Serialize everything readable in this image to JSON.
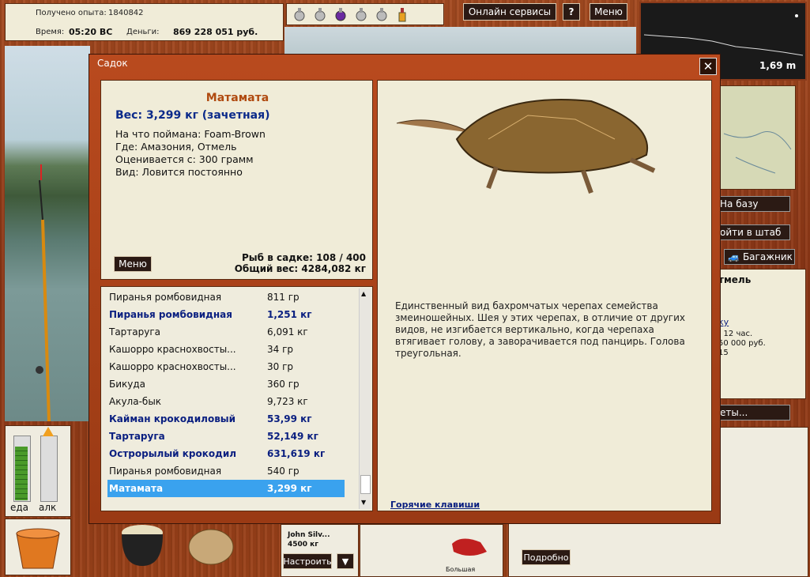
{
  "stats": {
    "xp_label": "Получено опыта:",
    "xp_value": "1840842",
    "time_label": "Время:",
    "time_value": "05:20 ВС",
    "money_label": "Деньги:",
    "money_value": "869 228 051 руб."
  },
  "topbar": {
    "online_services": "Онлайн сервисы",
    "help": "?",
    "menu": "Меню"
  },
  "depth": {
    "value": "1,69 m"
  },
  "dialog": {
    "title": "Садок",
    "close": "✕",
    "fish": {
      "name": "Матамата",
      "weight": "Вес: 3,299 кг (зачетная)",
      "caught_on": "На что поймана: Foam-Brown",
      "where": "Где: Амазония, Отмель",
      "valued_from": "Оценивается с: 300 грамм",
      "kind": "Вид: Ловится постоянно"
    },
    "menu_button": "Меню",
    "fish_in_keepnet": "Рыб в садке: 108 / 400",
    "total_weight": "Общий вес: 4284,082 кг",
    "list": [
      {
        "name": "Пиранья ромбовидная",
        "weight": "811 гр",
        "bold": false
      },
      {
        "name": "Пиранья ромбовидная",
        "weight": "1,251 кг",
        "bold": true
      },
      {
        "name": "Тартаруга",
        "weight": "6,091 кг",
        "bold": false
      },
      {
        "name": "Кашорро краснохвосты...",
        "weight": "34 гр",
        "bold": false
      },
      {
        "name": "Кашорро краснохвосты...",
        "weight": "30 гр",
        "bold": false
      },
      {
        "name": "Бикуда",
        "weight": "360 гр",
        "bold": false
      },
      {
        "name": "Акула-бык",
        "weight": "9,723 кг",
        "bold": false
      },
      {
        "name": "Кайман крокодиловый",
        "weight": "53,99 кг",
        "bold": true
      },
      {
        "name": "Тартаруга",
        "weight": "52,149 кг",
        "bold": true
      },
      {
        "name": "Острорылый крокодил",
        "weight": "631,619 кг",
        "bold": true
      },
      {
        "name": "Пиранья ромбовидная",
        "weight": "540 гр",
        "bold": false
      },
      {
        "name": "Матамата",
        "weight": "3,299 кг",
        "bold": true,
        "selected": true
      }
    ],
    "description": "Единственный вид бахромчатых черепах семейства змеиношейных. Шея у этих черепах, в отличие от других видов, не изгибается вертикально, когда черепаха втягивает голову, а заворачивается под панцирь. Голова треугольная.",
    "hotkeys": "Горячие клавиши"
  },
  "right": {
    "to_base": "На базу",
    "to_hq": "ойти в штаб",
    "trunk": "Багажник",
    "location": "тмель",
    "link": "ку",
    "line1": ": 12 час.",
    "line2": "50 000 руб.",
    "line3": "15",
    "tickets": "еты..."
  },
  "bottom": {
    "food": "еда",
    "alc": "алк",
    "bait_name": "John Silv...",
    "bait_weight": "4500 кг",
    "configure": "Настроить",
    "lure_size": "Большая",
    "details": "Подробно"
  }
}
